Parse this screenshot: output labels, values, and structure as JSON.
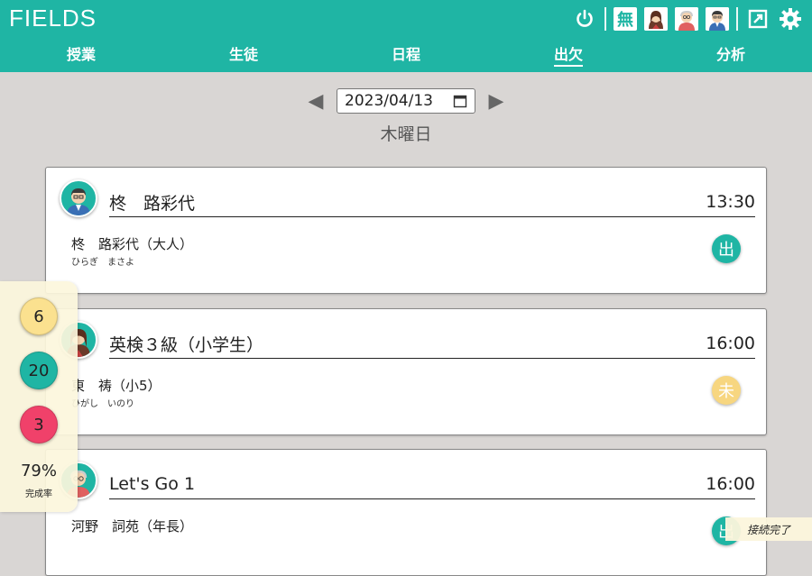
{
  "app": {
    "logo": "FIELDS"
  },
  "header": {
    "kanji_icon": "無",
    "icons": [
      "power-icon",
      "mu-icon",
      "teacher-female-icon",
      "teacher-elderly-icon",
      "teacher-male-icon",
      "fullscreen-icon",
      "gear-icon"
    ]
  },
  "nav": {
    "items": [
      {
        "label": "授業"
      },
      {
        "label": "生徒"
      },
      {
        "label": "日程"
      },
      {
        "label": "出欠"
      },
      {
        "label": "分析"
      }
    ],
    "active": "出欠"
  },
  "date": {
    "value": "2023/04/13",
    "weekday": "木曜日"
  },
  "lessons": [
    {
      "title": "柊　路彩代",
      "time": "13:30",
      "student_name": "柊　路彩代（大人）",
      "student_kana": "ひらぎ　まさよ",
      "status": "出",
      "status_color": "#1fb5a4"
    },
    {
      "title": "英検３級（小学生）",
      "time": "16:00",
      "student_name": "東　祷（小5）",
      "student_kana": "ひがし　いのり",
      "status": "未",
      "status_color": "#f7d680"
    },
    {
      "title": "Let's Go 1",
      "time": "16:00",
      "student_name": "河野　詞苑（年長）",
      "student_kana": "",
      "status": "出",
      "status_color": "#1fb5a4"
    }
  ],
  "stats": {
    "pending": "6",
    "pending_color": "#fbe18f",
    "present": "20",
    "present_color": "#1fb5a4",
    "absent": "3",
    "absent_color": "#f0416a",
    "rate": "79%",
    "rate_label": "完成率"
  },
  "connection_status": "接続完了"
}
